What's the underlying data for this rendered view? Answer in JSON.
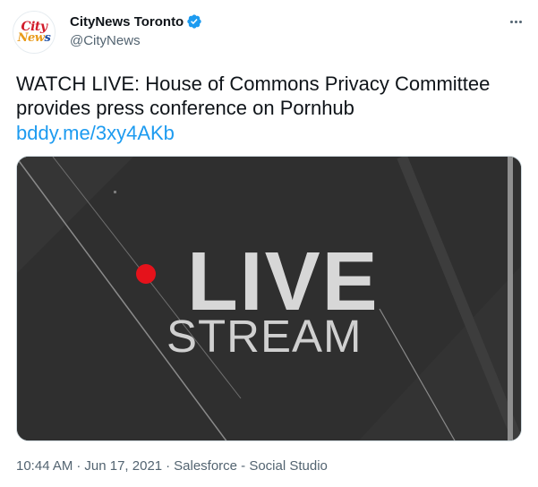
{
  "account": {
    "display_name": "CityNews Toronto",
    "handle": "@CityNews",
    "avatar_line1": "City",
    "avatar_line2a": "New",
    "avatar_line2b": "s",
    "verified": true
  },
  "tweet": {
    "text": "WATCH LIVE: House of Commons Privacy Committee provides press conference on Pornhub",
    "link": "bddy.me/3xy4AKb"
  },
  "media": {
    "live_word": "LIVE",
    "stream_word": "STREAM",
    "dot_color": "#e5121b"
  },
  "meta": {
    "time": "10:44 AM",
    "date": "Jun 17, 2021",
    "separator": "·",
    "source": "Salesforce - Social Studio"
  },
  "colors": {
    "accent_link": "#1d9bf0",
    "secondary_text": "#536471",
    "verified_badge": "#1d9bf0"
  },
  "icons": [
    "verified-badge-icon",
    "more-options-icon"
  ]
}
